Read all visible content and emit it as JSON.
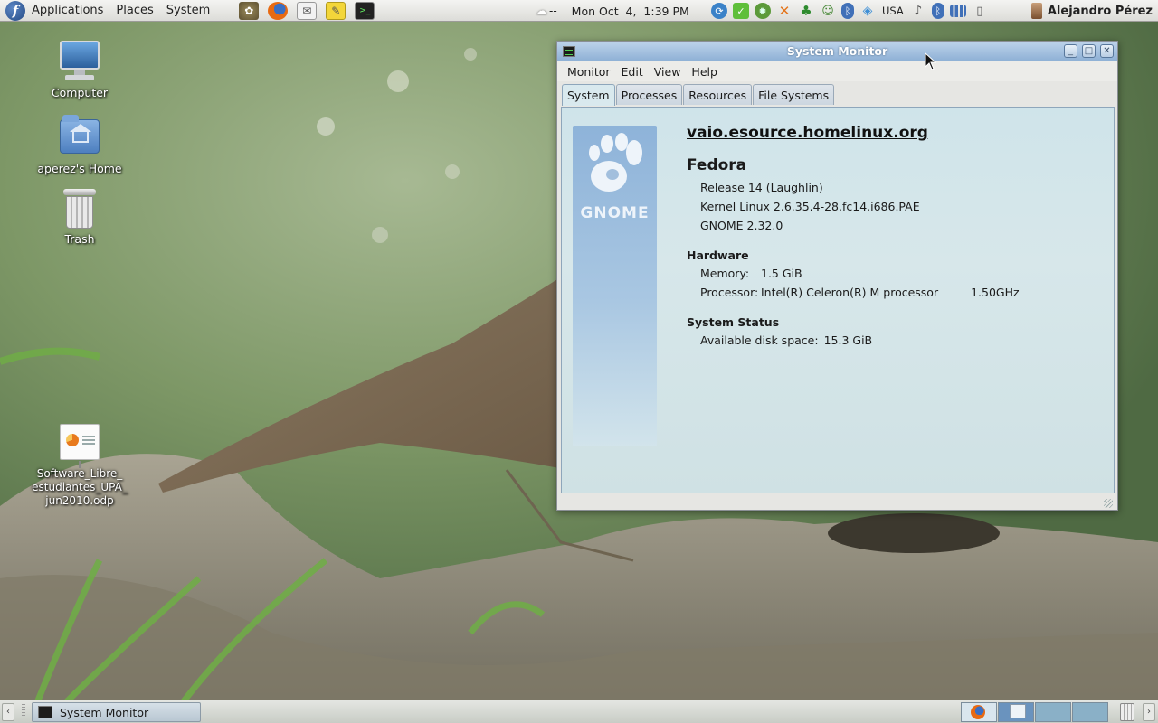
{
  "top_panel": {
    "menus": [
      "Applications",
      "Places",
      "System"
    ],
    "launchers": [
      "gimp-icon",
      "firefox-icon",
      "mail-icon",
      "notes-icon",
      "terminal-icon"
    ],
    "weather_text": "--",
    "clock": "Mon Oct  4,  1:39 PM",
    "keyboard_layout": "USA",
    "user_name": "Alejandro Pérez"
  },
  "desktop": {
    "icons": [
      {
        "label": "Computer"
      },
      {
        "label": "aperez's Home"
      },
      {
        "label": "Trash"
      },
      {
        "label": "Software_Libre_\nestudiantes_UPA_\njun2010.odp"
      }
    ]
  },
  "window": {
    "title": "System Monitor",
    "menus": [
      "Monitor",
      "Edit",
      "View",
      "Help"
    ],
    "tabs": [
      "System",
      "Processes",
      "Resources",
      "File Systems"
    ],
    "active_tab": "System",
    "system": {
      "hostname": "vaio.esource.homelinux.org",
      "distro": "Fedora",
      "release": "Release 14 (Laughlin)",
      "kernel": "Kernel Linux 2.6.35.4-28.fc14.i686.PAE",
      "gnome": "GNOME 2.32.0",
      "hardware_title": "Hardware",
      "memory_label": "Memory:",
      "memory_value": "1.5 GiB",
      "processor_label": "Processor:",
      "processor_value": "Intel(R) Celeron(R) M processor",
      "processor_speed": "1.50GHz",
      "status_title": "System Status",
      "disk_label": "Available disk space:",
      "disk_value": "15.3 GiB"
    },
    "logo_text": "GNOME"
  },
  "bottom_panel": {
    "task_label": "System Monitor",
    "left_arrow": "‹",
    "right_arrow": "›"
  },
  "colors": {
    "titlebar": "#8fb1d6",
    "tab_panel": "#d7e7ea",
    "wallpaper_green": "#6e8a5e"
  }
}
